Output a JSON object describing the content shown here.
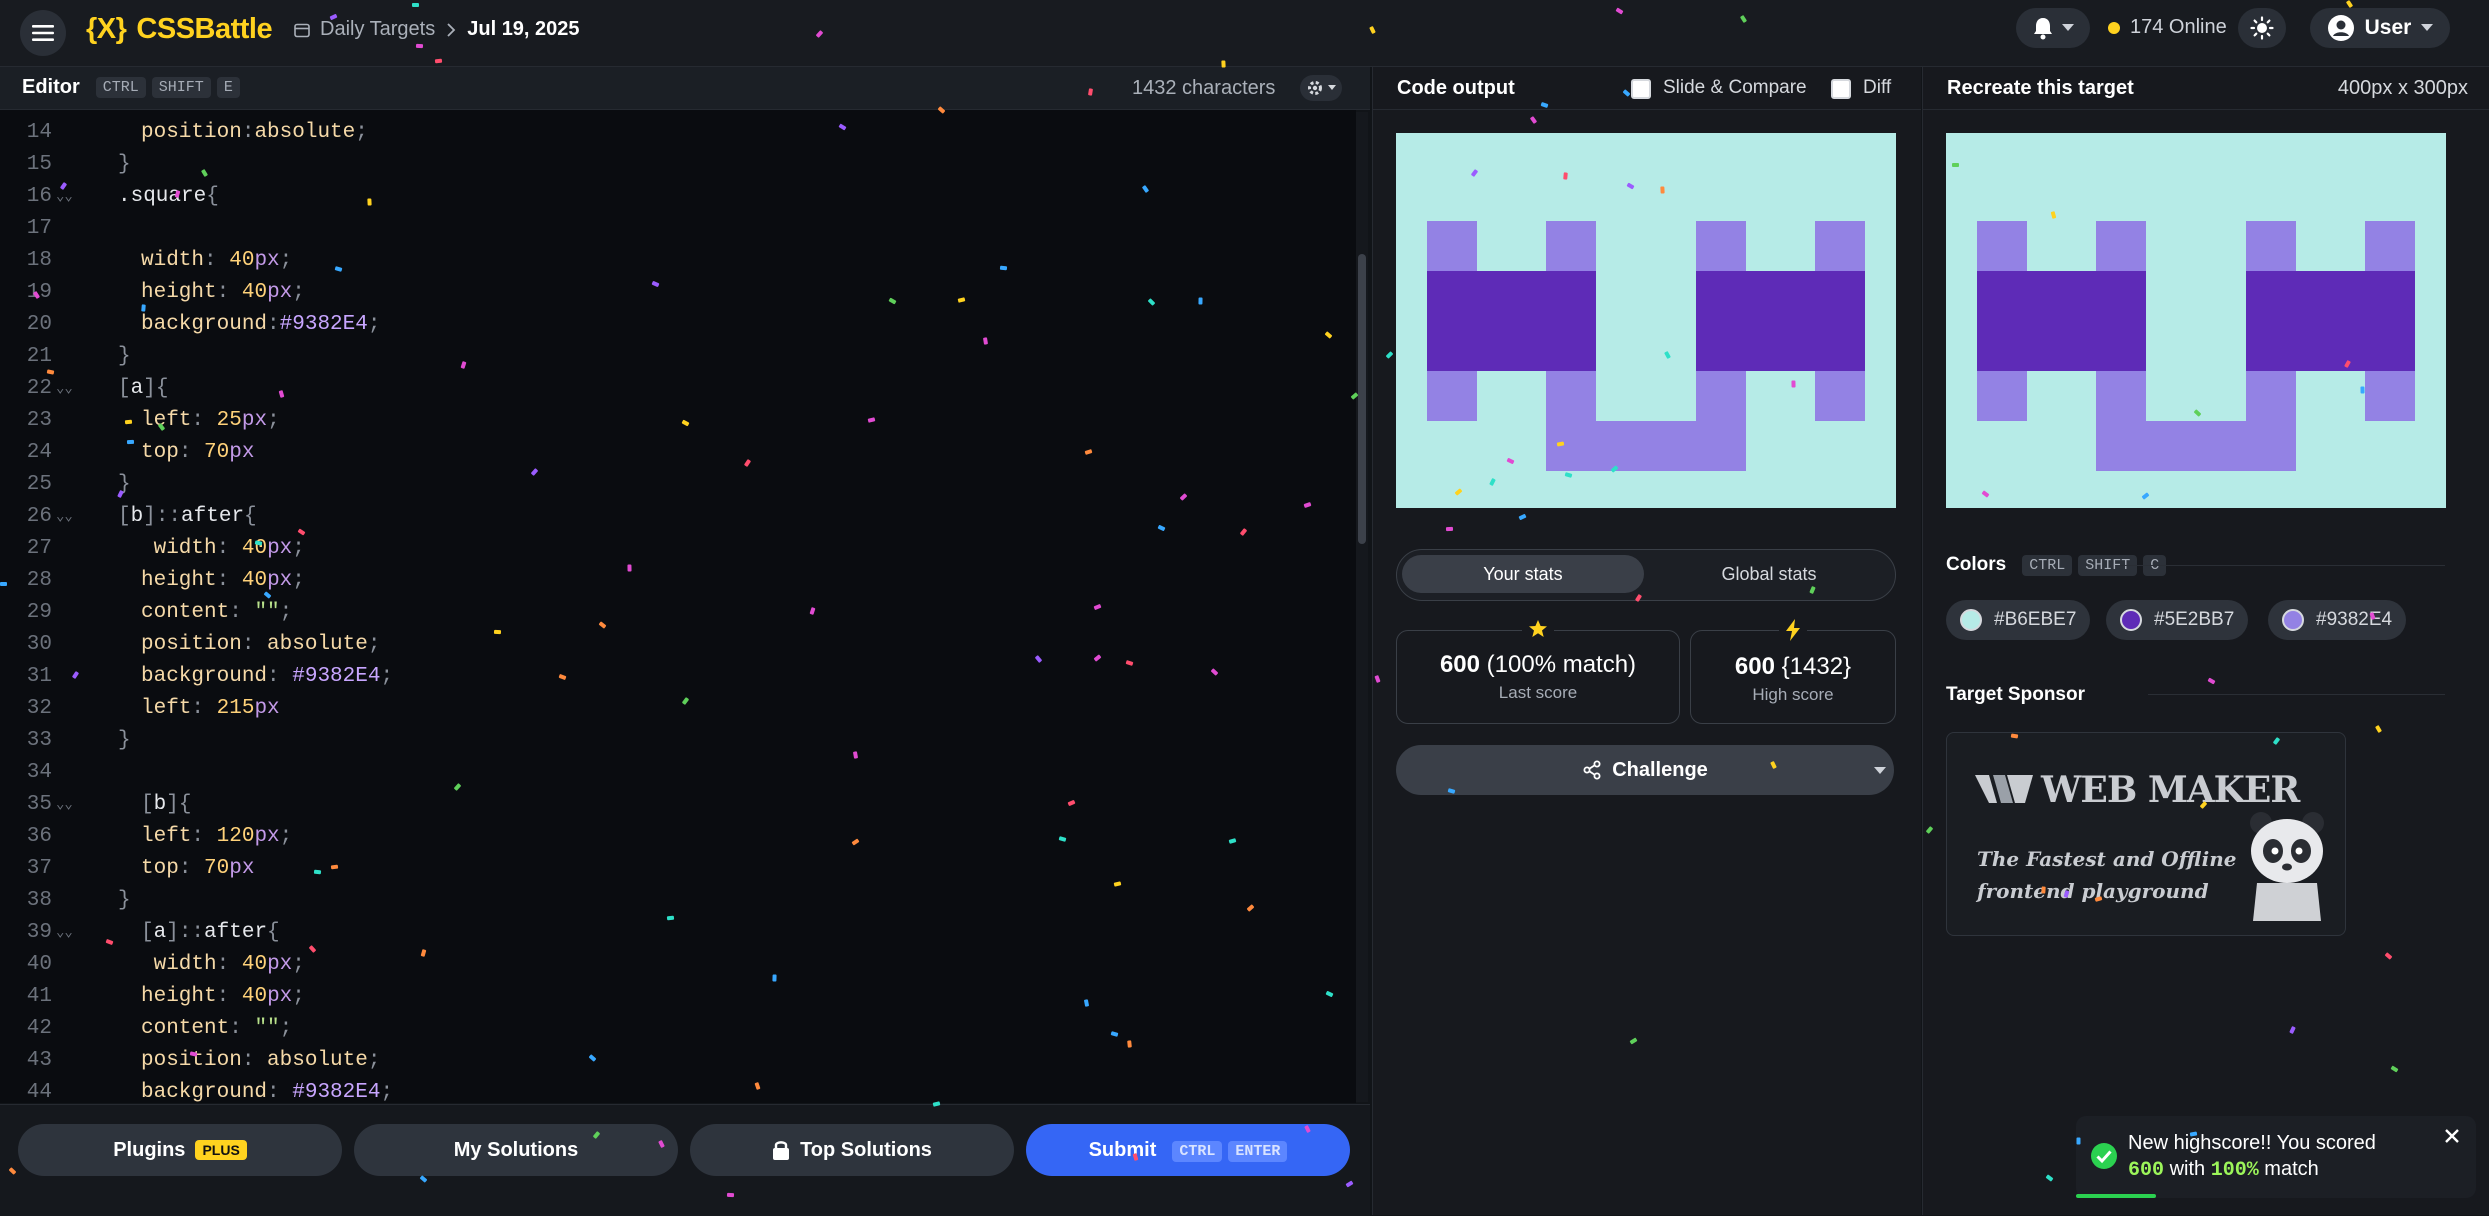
{
  "header": {
    "logo_mark": "{X}",
    "brand": "CSSBattle",
    "breadcrumb_section": "Daily Targets",
    "breadcrumb_current": "Jul 19, 2025",
    "online_count": "174 Online",
    "user_label": "User"
  },
  "editor": {
    "title": "Editor",
    "shortcut": [
      "CTRL",
      "SHIFT",
      "E"
    ],
    "char_count": "1432 characters",
    "lines": [
      {
        "n": "14",
        "fold": false,
        "indent": 1,
        "parts": [
          [
            "prop",
            "position"
          ],
          [
            "punct",
            ":"
          ],
          [
            "prop",
            "absolute"
          ],
          [
            "punct",
            ";"
          ]
        ]
      },
      {
        "n": "15",
        "fold": false,
        "indent": 0,
        "parts": [
          [
            "punct",
            "}"
          ]
        ]
      },
      {
        "n": "16",
        "fold": true,
        "indent": 0,
        "parts": [
          [
            "sel",
            ".square"
          ],
          [
            "punct",
            "{"
          ]
        ]
      },
      {
        "n": "17",
        "fold": false,
        "indent": 0,
        "parts": []
      },
      {
        "n": "18",
        "fold": false,
        "indent": 1,
        "parts": [
          [
            "prop",
            "width"
          ],
          [
            "punct",
            ": "
          ],
          [
            "num",
            "40"
          ],
          [
            "unit",
            "px"
          ],
          [
            "punct",
            ";"
          ]
        ]
      },
      {
        "n": "19",
        "fold": false,
        "indent": 1,
        "parts": [
          [
            "prop",
            "height"
          ],
          [
            "punct",
            ": "
          ],
          [
            "num",
            "40"
          ],
          [
            "unit",
            "px"
          ],
          [
            "punct",
            ";"
          ]
        ]
      },
      {
        "n": "20",
        "fold": false,
        "indent": 1,
        "parts": [
          [
            "prop",
            "background"
          ],
          [
            "punct",
            ":"
          ],
          [
            "hash",
            "#9382E4"
          ],
          [
            "punct",
            ";"
          ]
        ]
      },
      {
        "n": "21",
        "fold": false,
        "indent": 0,
        "parts": [
          [
            "punct",
            "}"
          ]
        ]
      },
      {
        "n": "22",
        "fold": true,
        "indent": 0,
        "parts": [
          [
            "punct",
            "["
          ],
          [
            "sel",
            "a"
          ],
          [
            "punct",
            "]{"
          ]
        ]
      },
      {
        "n": "23",
        "fold": false,
        "indent": 1,
        "parts": [
          [
            "prop",
            "left"
          ],
          [
            "punct",
            ": "
          ],
          [
            "num",
            "25"
          ],
          [
            "unit",
            "px"
          ],
          [
            "punct",
            ";"
          ]
        ]
      },
      {
        "n": "24",
        "fold": false,
        "indent": 1,
        "parts": [
          [
            "prop",
            "top"
          ],
          [
            "punct",
            ": "
          ],
          [
            "num",
            "70"
          ],
          [
            "unit",
            "px"
          ]
        ]
      },
      {
        "n": "25",
        "fold": false,
        "indent": 0,
        "parts": [
          [
            "punct",
            "}"
          ]
        ]
      },
      {
        "n": "26",
        "fold": true,
        "indent": 0,
        "parts": [
          [
            "punct",
            "["
          ],
          [
            "sel",
            "b"
          ],
          [
            "punct",
            "]::"
          ],
          [
            "sel",
            "after"
          ],
          [
            "punct",
            "{"
          ]
        ]
      },
      {
        "n": "27",
        "fold": false,
        "indent": 1,
        "parts": [
          [
            "prop",
            " width"
          ],
          [
            "punct",
            ": "
          ],
          [
            "num",
            "40"
          ],
          [
            "unit",
            "px"
          ],
          [
            "punct",
            ";"
          ]
        ]
      },
      {
        "n": "28",
        "fold": false,
        "indent": 1,
        "parts": [
          [
            "prop",
            "height"
          ],
          [
            "punct",
            ": "
          ],
          [
            "num",
            "40"
          ],
          [
            "unit",
            "px"
          ],
          [
            "punct",
            ";"
          ]
        ]
      },
      {
        "n": "29",
        "fold": false,
        "indent": 1,
        "parts": [
          [
            "prop",
            "content"
          ],
          [
            "punct",
            ": "
          ],
          [
            "str",
            "\"\""
          ],
          [
            "punct",
            ";"
          ]
        ]
      },
      {
        "n": "30",
        "fold": false,
        "indent": 1,
        "parts": [
          [
            "prop",
            "position"
          ],
          [
            "punct",
            ": "
          ],
          [
            "prop",
            "absolute"
          ],
          [
            "punct",
            ";"
          ]
        ]
      },
      {
        "n": "31",
        "fold": false,
        "indent": 1,
        "parts": [
          [
            "prop",
            "background"
          ],
          [
            "punct",
            ": "
          ],
          [
            "hash",
            "#9382E4"
          ],
          [
            "punct",
            ";"
          ]
        ]
      },
      {
        "n": "32",
        "fold": false,
        "indent": 1,
        "parts": [
          [
            "prop",
            "left"
          ],
          [
            "punct",
            ": "
          ],
          [
            "num",
            "215"
          ],
          [
            "unit",
            "px"
          ]
        ]
      },
      {
        "n": "33",
        "fold": false,
        "indent": 0,
        "parts": [
          [
            "punct",
            "}"
          ]
        ]
      },
      {
        "n": "34",
        "fold": false,
        "indent": 0,
        "parts": []
      },
      {
        "n": "35",
        "fold": true,
        "indent": 1,
        "parts": [
          [
            "punct",
            "["
          ],
          [
            "sel",
            "b"
          ],
          [
            "punct",
            "]{"
          ]
        ]
      },
      {
        "n": "36",
        "fold": false,
        "indent": 1,
        "parts": [
          [
            "prop",
            "left"
          ],
          [
            "punct",
            ": "
          ],
          [
            "num",
            "120"
          ],
          [
            "unit",
            "px"
          ],
          [
            "punct",
            ";"
          ]
        ]
      },
      {
        "n": "37",
        "fold": false,
        "indent": 1,
        "parts": [
          [
            "prop",
            "top"
          ],
          [
            "punct",
            ": "
          ],
          [
            "num",
            "70"
          ],
          [
            "unit",
            "px"
          ]
        ]
      },
      {
        "n": "38",
        "fold": false,
        "indent": 0,
        "parts": [
          [
            "punct",
            "}"
          ]
        ]
      },
      {
        "n": "39",
        "fold": true,
        "indent": 1,
        "parts": [
          [
            "punct",
            "["
          ],
          [
            "sel",
            "a"
          ],
          [
            "punct",
            "]::"
          ],
          [
            "sel",
            "after"
          ],
          [
            "punct",
            "{"
          ]
        ]
      },
      {
        "n": "40",
        "fold": false,
        "indent": 1,
        "parts": [
          [
            "prop",
            " width"
          ],
          [
            "punct",
            ": "
          ],
          [
            "num",
            "40"
          ],
          [
            "unit",
            "px"
          ],
          [
            "punct",
            ";"
          ]
        ]
      },
      {
        "n": "41",
        "fold": false,
        "indent": 1,
        "parts": [
          [
            "prop",
            "height"
          ],
          [
            "punct",
            ": "
          ],
          [
            "num",
            "40"
          ],
          [
            "unit",
            "px"
          ],
          [
            "punct",
            ";"
          ]
        ]
      },
      {
        "n": "42",
        "fold": false,
        "indent": 1,
        "parts": [
          [
            "prop",
            "content"
          ],
          [
            "punct",
            ": "
          ],
          [
            "str",
            "\"\""
          ],
          [
            "punct",
            ";"
          ]
        ]
      },
      {
        "n": "43",
        "fold": false,
        "indent": 1,
        "parts": [
          [
            "prop",
            "position"
          ],
          [
            "punct",
            ": "
          ],
          [
            "prop",
            "absolute"
          ],
          [
            "punct",
            ";"
          ]
        ]
      },
      {
        "n": "44",
        "fold": false,
        "indent": 1,
        "parts": [
          [
            "prop",
            "background"
          ],
          [
            "punct",
            ": "
          ],
          [
            "hash",
            "#9382E4"
          ],
          [
            "punct",
            ";"
          ]
        ]
      }
    ]
  },
  "bottom_buttons": {
    "plugins": "Plugins",
    "plugins_badge": "PLUS",
    "my_solutions": "My Solutions",
    "top_solutions": "Top Solutions",
    "submit": "Submit",
    "submit_shortcut": [
      "CTRL",
      "ENTER"
    ]
  },
  "output": {
    "title": "Code output",
    "slide_compare": "Slide & Compare",
    "diff": "Diff"
  },
  "stats": {
    "tab_yours": "Your stats",
    "tab_global": "Global stats",
    "last_score_value": "600",
    "last_score_match": "(100% match)",
    "last_score_label": "Last score",
    "high_score_value": "600",
    "high_score_chars": "{1432}",
    "high_score_label": "High score",
    "challenge": "Challenge"
  },
  "target": {
    "title": "Recreate this target",
    "size": "400px x 300px",
    "colors_label": "Colors",
    "colors_shortcut": [
      "CTRL",
      "SHIFT",
      "C"
    ],
    "colors": [
      "#B6EBE7",
      "#5E2BB7",
      "#9382E4"
    ],
    "sponsor_label": "Target Sponsor",
    "sponsor_name": "WEB MAKER",
    "sponsor_tagline_1": "The Fastest and Offline",
    "sponsor_tagline_2": "frontend playground"
  },
  "toast": {
    "line1": "New highscore!! You scored",
    "score": "600",
    "with": "with",
    "match": "100%",
    "match_word": "match"
  },
  "palette": {
    "bg": "#B6EBE7",
    "dark": "#5E2BB7",
    "light": "#9382E4",
    "accent": "#FFD21F",
    "submit": "#3566F5"
  }
}
